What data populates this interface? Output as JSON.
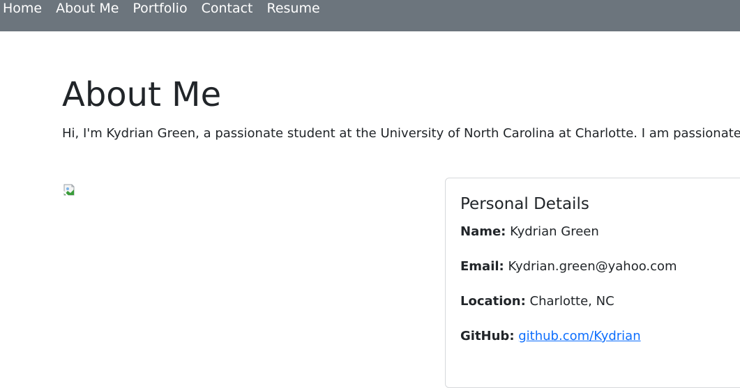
{
  "nav": {
    "items": [
      "Home",
      "About Me",
      "Portfolio",
      "Contact",
      "Resume"
    ]
  },
  "main": {
    "title": "About Me",
    "intro": "Hi, I'm Kydrian Green, a passionate student at the University of North Carolina at Charlotte. I am passionate abo"
  },
  "details": {
    "title": "Personal Details",
    "name_label": "Name:",
    "name_value": "Kydrian Green",
    "email_label": "Email:",
    "email_value": "Kydrian.green@yahoo.com",
    "location_label": "Location:",
    "location_value": "Charlotte, NC",
    "github_label": "GitHub:",
    "github_value": "github.com/Kydrian"
  },
  "colors": {
    "navbar": "#6c757d",
    "link": "#0d6efd",
    "text": "#212529"
  },
  "icons": {
    "profile_image": "broken-image-icon"
  }
}
